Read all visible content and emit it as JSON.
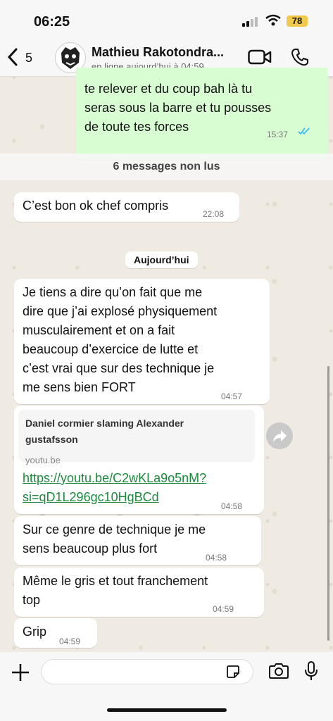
{
  "status_bar": {
    "time": "06:25",
    "battery": "78"
  },
  "header": {
    "back_count": "5",
    "contact_name": "Mathieu  Rakotondra...",
    "status": "en ligne aujourd’hui à 04:59"
  },
  "messages": {
    "m1_lines": [
      "te relever et du coup bah là tu",
      "seras sous la barre et tu pousses",
      "de toute tes forces"
    ],
    "m1_time": "15:37",
    "unread_label": "6 messages non lus",
    "m2_text": "C’est bon ok chef compris",
    "m2_time": "22:08",
    "date_label": "Aujourd’hui",
    "m3_lines": [
      "Je tiens a dire qu’on fait que me",
      "dire que j’ai explosé physiquement",
      "musculairement et on a fait",
      "beaucoup d’exercice de lutte et",
      "c’est vrai que sur des technique je",
      "me sens bien FORT"
    ],
    "m3_time": "04:57",
    "link_title_lines": [
      "Daniel cormier slaming Alexander",
      "gustafsson"
    ],
    "link_domain": "youtu.be",
    "m4_url_lines": [
      "https://youtu.be/C2wKLa9o5nM?",
      "si=qD1L296gc10HgBCd"
    ],
    "m4_time": "04:58",
    "m5_lines": [
      "Sur ce genre de technique je me",
      "sens beaucoup plus fort"
    ],
    "m5_time": "04:58",
    "m6_lines": [
      "Même le gris et tout franchement",
      "top"
    ],
    "m6_time": "04:59",
    "m7_text": "Grip",
    "m7_time": "04:59"
  },
  "colors": {
    "outgoing": "#d9fdd3",
    "incoming": "#ffffff",
    "link": "#1b8a3c",
    "read_ticks": "#34b7f1",
    "battery": "#f2c94c"
  },
  "icons": [
    "back-chevron-icon",
    "video-call-icon",
    "phone-icon",
    "double-check-icon",
    "forward-icon",
    "plus-icon",
    "sticker-icon",
    "camera-icon",
    "mic-icon"
  ]
}
